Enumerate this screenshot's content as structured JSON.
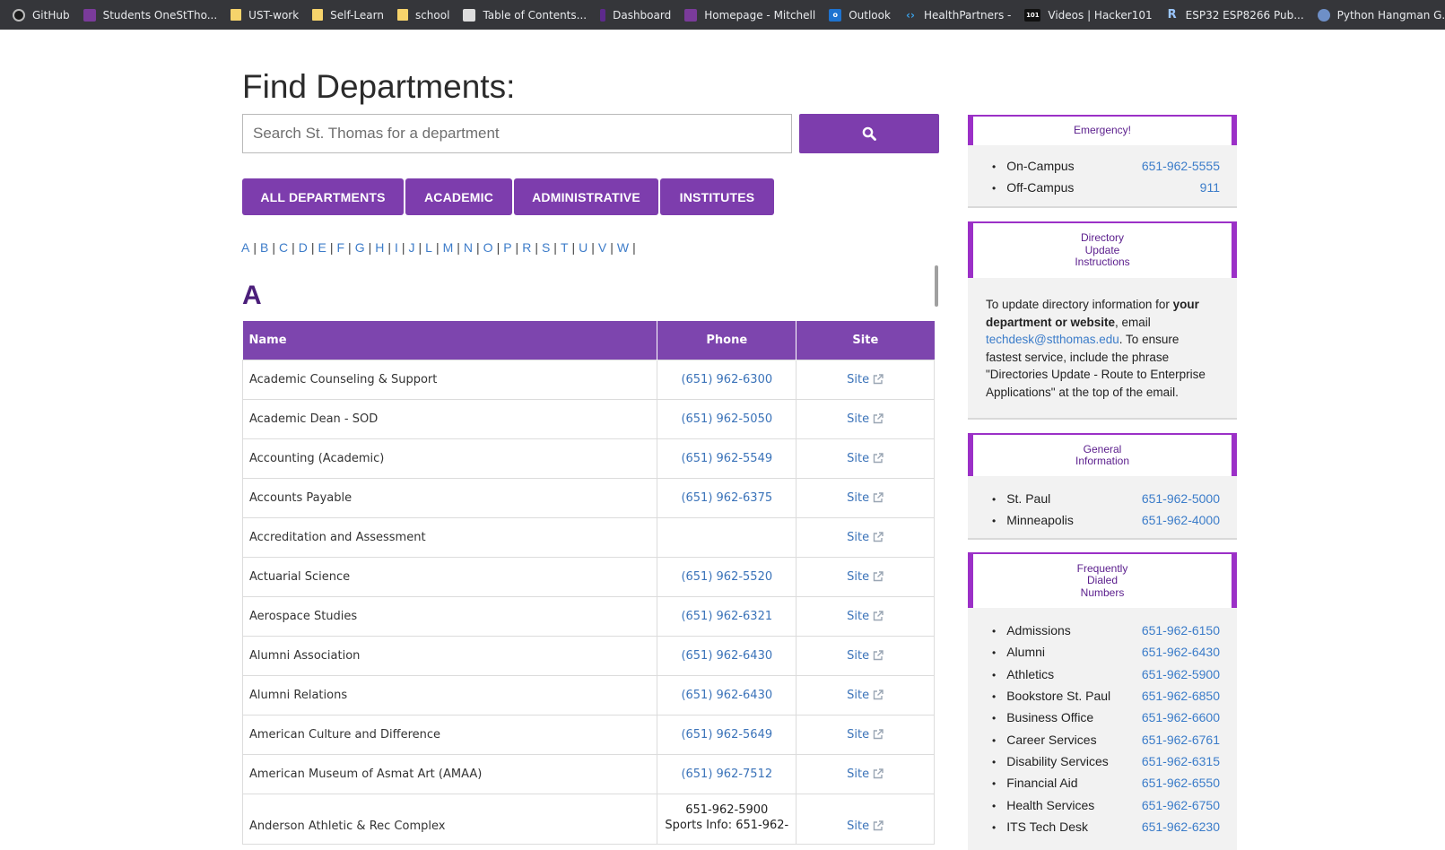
{
  "bookmarks": [
    {
      "label": "GitHub",
      "icon": "github-icon"
    },
    {
      "label": "Students OneStTho...",
      "icon": "shield-icon"
    },
    {
      "label": "UST-work",
      "icon": "folder-icon"
    },
    {
      "label": "Self-Learn",
      "icon": "folder-icon"
    },
    {
      "label": "school",
      "icon": "folder-icon"
    },
    {
      "label": "Table of Contents...",
      "icon": "doc-icon"
    },
    {
      "label": "Dashboard",
      "icon": "dashboard-icon"
    },
    {
      "label": "Homepage - Mitchell",
      "icon": "shield-icon"
    },
    {
      "label": "Outlook",
      "icon": "outlook-icon"
    },
    {
      "label": "HealthPartners -",
      "icon": "healthpartners-icon"
    },
    {
      "label": "Videos | Hacker101",
      "icon": "hacker101-icon"
    },
    {
      "label": "ESP32 ESP8266 Pub...",
      "icon": "r-icon"
    },
    {
      "label": "Python Hangman G...",
      "icon": "python-icon"
    }
  ],
  "page": {
    "title": "Find Departments:",
    "search_placeholder": "Search St. Thomas for a department"
  },
  "filters": [
    "ALL DEPARTMENTS",
    "ACADEMIC",
    "ADMINISTRATIVE",
    "INSTITUTES"
  ],
  "alphabet": [
    "A",
    "B",
    "C",
    "D",
    "E",
    "F",
    "G",
    "H",
    "I",
    "J",
    "L",
    "M",
    "N",
    "O",
    "P",
    "R",
    "S",
    "T",
    "U",
    "V",
    "W"
  ],
  "section_letter": "A",
  "table": {
    "headers": {
      "name": "Name",
      "phone": "Phone",
      "site": "Site"
    },
    "rows": [
      {
        "name": "Academic Counseling & Support",
        "phone": "(651) 962-6300",
        "site": "Site"
      },
      {
        "name": "Academic Dean - SOD",
        "phone": "(651) 962-5050",
        "site": "Site"
      },
      {
        "name": "Accounting (Academic)",
        "phone": "(651) 962-5549",
        "site": "Site"
      },
      {
        "name": "Accounts Payable",
        "phone": "(651) 962-6375",
        "site": "Site"
      },
      {
        "name": "Accreditation and Assessment",
        "phone": "",
        "site": "Site"
      },
      {
        "name": "Actuarial Science",
        "phone": "(651) 962-5520",
        "site": "Site"
      },
      {
        "name": "Aerospace Studies",
        "phone": "(651) 962-6321",
        "site": "Site"
      },
      {
        "name": "Alumni Association",
        "phone": "(651) 962-6430",
        "site": "Site"
      },
      {
        "name": "Alumni Relations",
        "phone": "(651) 962-6430",
        "site": "Site"
      },
      {
        "name": "American Culture and Difference",
        "phone": "(651) 962-5649",
        "site": "Site"
      },
      {
        "name": "American Museum of Asmat Art (AMAA)",
        "phone": "(651) 962-7512",
        "site": "Site"
      }
    ],
    "last_row": {
      "name": "Anderson Athletic & Rec Complex",
      "phone_line1": "651-962-5900",
      "phone_line2": "Sports Info: 651-962-",
      "site": "Site"
    }
  },
  "sidebar": {
    "emergency": {
      "title": "Emergency!",
      "items": [
        {
          "label": "On-Campus",
          "number": "651-962-5555"
        },
        {
          "label": "Off-Campus",
          "number": "911"
        }
      ]
    },
    "directory": {
      "title_lines": [
        "Directory",
        "Update",
        "Instructions"
      ],
      "text1": "To update directory information for ",
      "bold1": "your department or website",
      "text2": ", email ",
      "email": "techdesk@stthomas.edu",
      "text3": ". To ensure fastest service, include the phrase \"Directories Update - Route to Enterprise Applications\" at the top of the email."
    },
    "general": {
      "title_lines": [
        "General",
        "Information"
      ],
      "items": [
        {
          "label": "St. Paul",
          "number": "651-962-5000"
        },
        {
          "label": "Minneapolis",
          "number": "651-962-4000"
        }
      ]
    },
    "frequent": {
      "title_lines": [
        "Frequently",
        "Dialed",
        "Numbers"
      ],
      "items": [
        {
          "label": "Admissions",
          "number": "651-962-6150"
        },
        {
          "label": "Alumni",
          "number": "651-962-6430"
        },
        {
          "label": "Athletics",
          "number": "651-962-5900"
        },
        {
          "label": "Bookstore St. Paul",
          "number": "651-962-6850"
        },
        {
          "label": "Business Office",
          "number": "651-962-6600"
        },
        {
          "label": "Career Services",
          "number": "651-962-6761"
        },
        {
          "label": "Disability Services",
          "number": "651-962-6315"
        },
        {
          "label": "Financial Aid",
          "number": "651-962-6550"
        },
        {
          "label": "Health Services",
          "number": "651-962-6750"
        },
        {
          "label": "ITS Tech Desk",
          "number": "651-962-6230"
        }
      ]
    }
  },
  "colors": {
    "purple": "#7d3dad",
    "link": "#3b7cc9",
    "heading": "#4b1e7a"
  }
}
